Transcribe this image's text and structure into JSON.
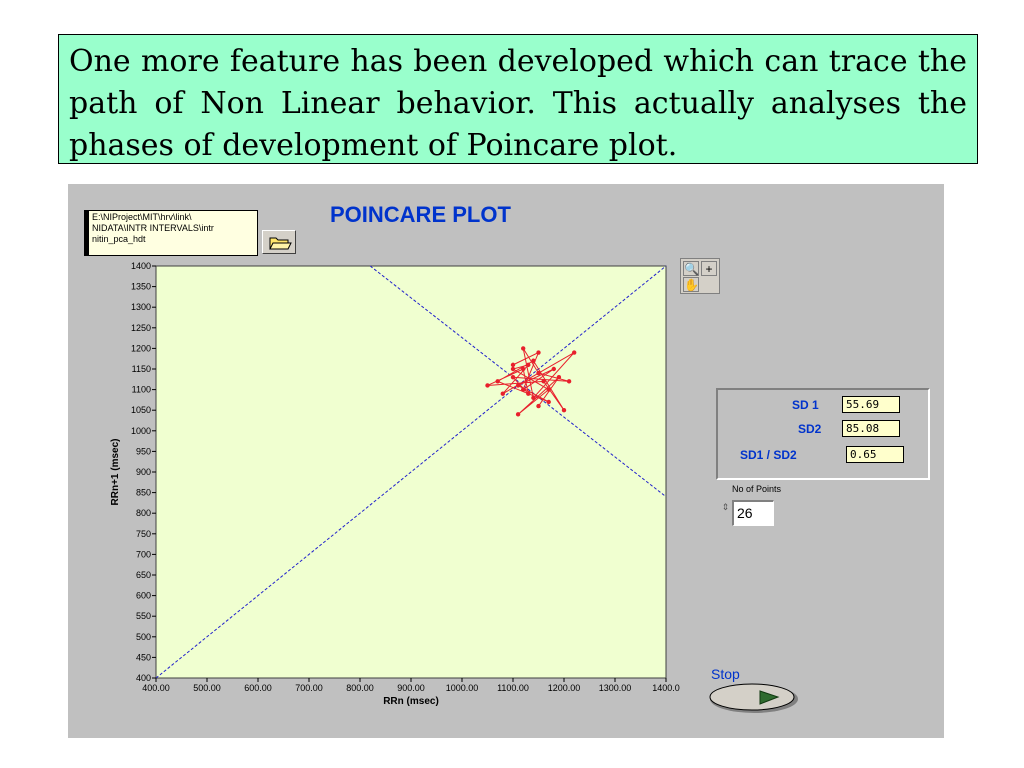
{
  "caption": {
    "text": "One more feature has been developed which can trace the path of Non Linear behavior. This actually analyses the phases of  development of Poincare plot."
  },
  "vi": {
    "path_lines": [
      "E:\\NIProject\\MIT\\hrv\\link\\",
      "NIDATA\\INTR INTERVALS\\intr",
      "nitin_pca_hdt"
    ],
    "plot_title": "POINCARE PLOT",
    "sd_labels": {
      "sd1": "SD 1",
      "sd2": "SD2",
      "ratio": "SD1 / SD2"
    },
    "sd_values": {
      "sd1": "55.69",
      "sd2": "85.08",
      "ratio": "0.65"
    },
    "points_label": "No of Points",
    "points_value": "26",
    "stop_label": "Stop",
    "tool_icons": [
      "zoom-icon",
      "cursor-plus-icon",
      "hand-pan-icon"
    ],
    "colors": {
      "plot_bg": "#f0ffd0",
      "series": "#e8202c",
      "title": "#0033cc",
      "guide": "#2222cc"
    }
  },
  "chart_data": {
    "type": "scatter",
    "title": "POINCARE PLOT",
    "xlabel": "RRn (msec)",
    "ylabel": "RRn+1 (msec)",
    "xlim": [
      400,
      1400
    ],
    "ylim": [
      400,
      1400
    ],
    "x_ticks": [
      "400.00",
      "500.00",
      "600.00",
      "700.00",
      "800.00",
      "900.00",
      "1000.00",
      "1100.00",
      "1200.00",
      "1300.00",
      "1400.0"
    ],
    "y_ticks": [
      "1400",
      "1350",
      "1300",
      "1250",
      "1200",
      "1150",
      "1100",
      "1050",
      "1000",
      "950",
      "900",
      "850",
      "800",
      "750",
      "700",
      "650",
      "600",
      "550",
      "500",
      "450",
      "400"
    ],
    "connected": true,
    "points": [
      {
        "x": 1100,
        "y": 1160
      },
      {
        "x": 1150,
        "y": 1190
      },
      {
        "x": 1120,
        "y": 1100
      },
      {
        "x": 1180,
        "y": 1150
      },
      {
        "x": 1110,
        "y": 1110
      },
      {
        "x": 1170,
        "y": 1070
      },
      {
        "x": 1070,
        "y": 1120
      },
      {
        "x": 1140,
        "y": 1170
      },
      {
        "x": 1200,
        "y": 1050
      },
      {
        "x": 1160,
        "y": 1120
      },
      {
        "x": 1050,
        "y": 1110
      },
      {
        "x": 1120,
        "y": 1150
      },
      {
        "x": 1130,
        "y": 1090
      },
      {
        "x": 1100,
        "y": 1130
      },
      {
        "x": 1210,
        "y": 1120
      },
      {
        "x": 1150,
        "y": 1140
      },
      {
        "x": 1120,
        "y": 1200
      },
      {
        "x": 1140,
        "y": 1080
      },
      {
        "x": 1220,
        "y": 1190
      },
      {
        "x": 1080,
        "y": 1090
      },
      {
        "x": 1130,
        "y": 1160
      },
      {
        "x": 1100,
        "y": 1150
      },
      {
        "x": 1170,
        "y": 1100
      },
      {
        "x": 1110,
        "y": 1040
      },
      {
        "x": 1190,
        "y": 1130
      },
      {
        "x": 1150,
        "y": 1060
      }
    ],
    "guide_lines": [
      {
        "from": [
          400,
          400
        ],
        "to": [
          1400,
          1400
        ]
      },
      {
        "from": [
          820,
          1400
        ],
        "to": [
          1400,
          840
        ]
      }
    ]
  }
}
